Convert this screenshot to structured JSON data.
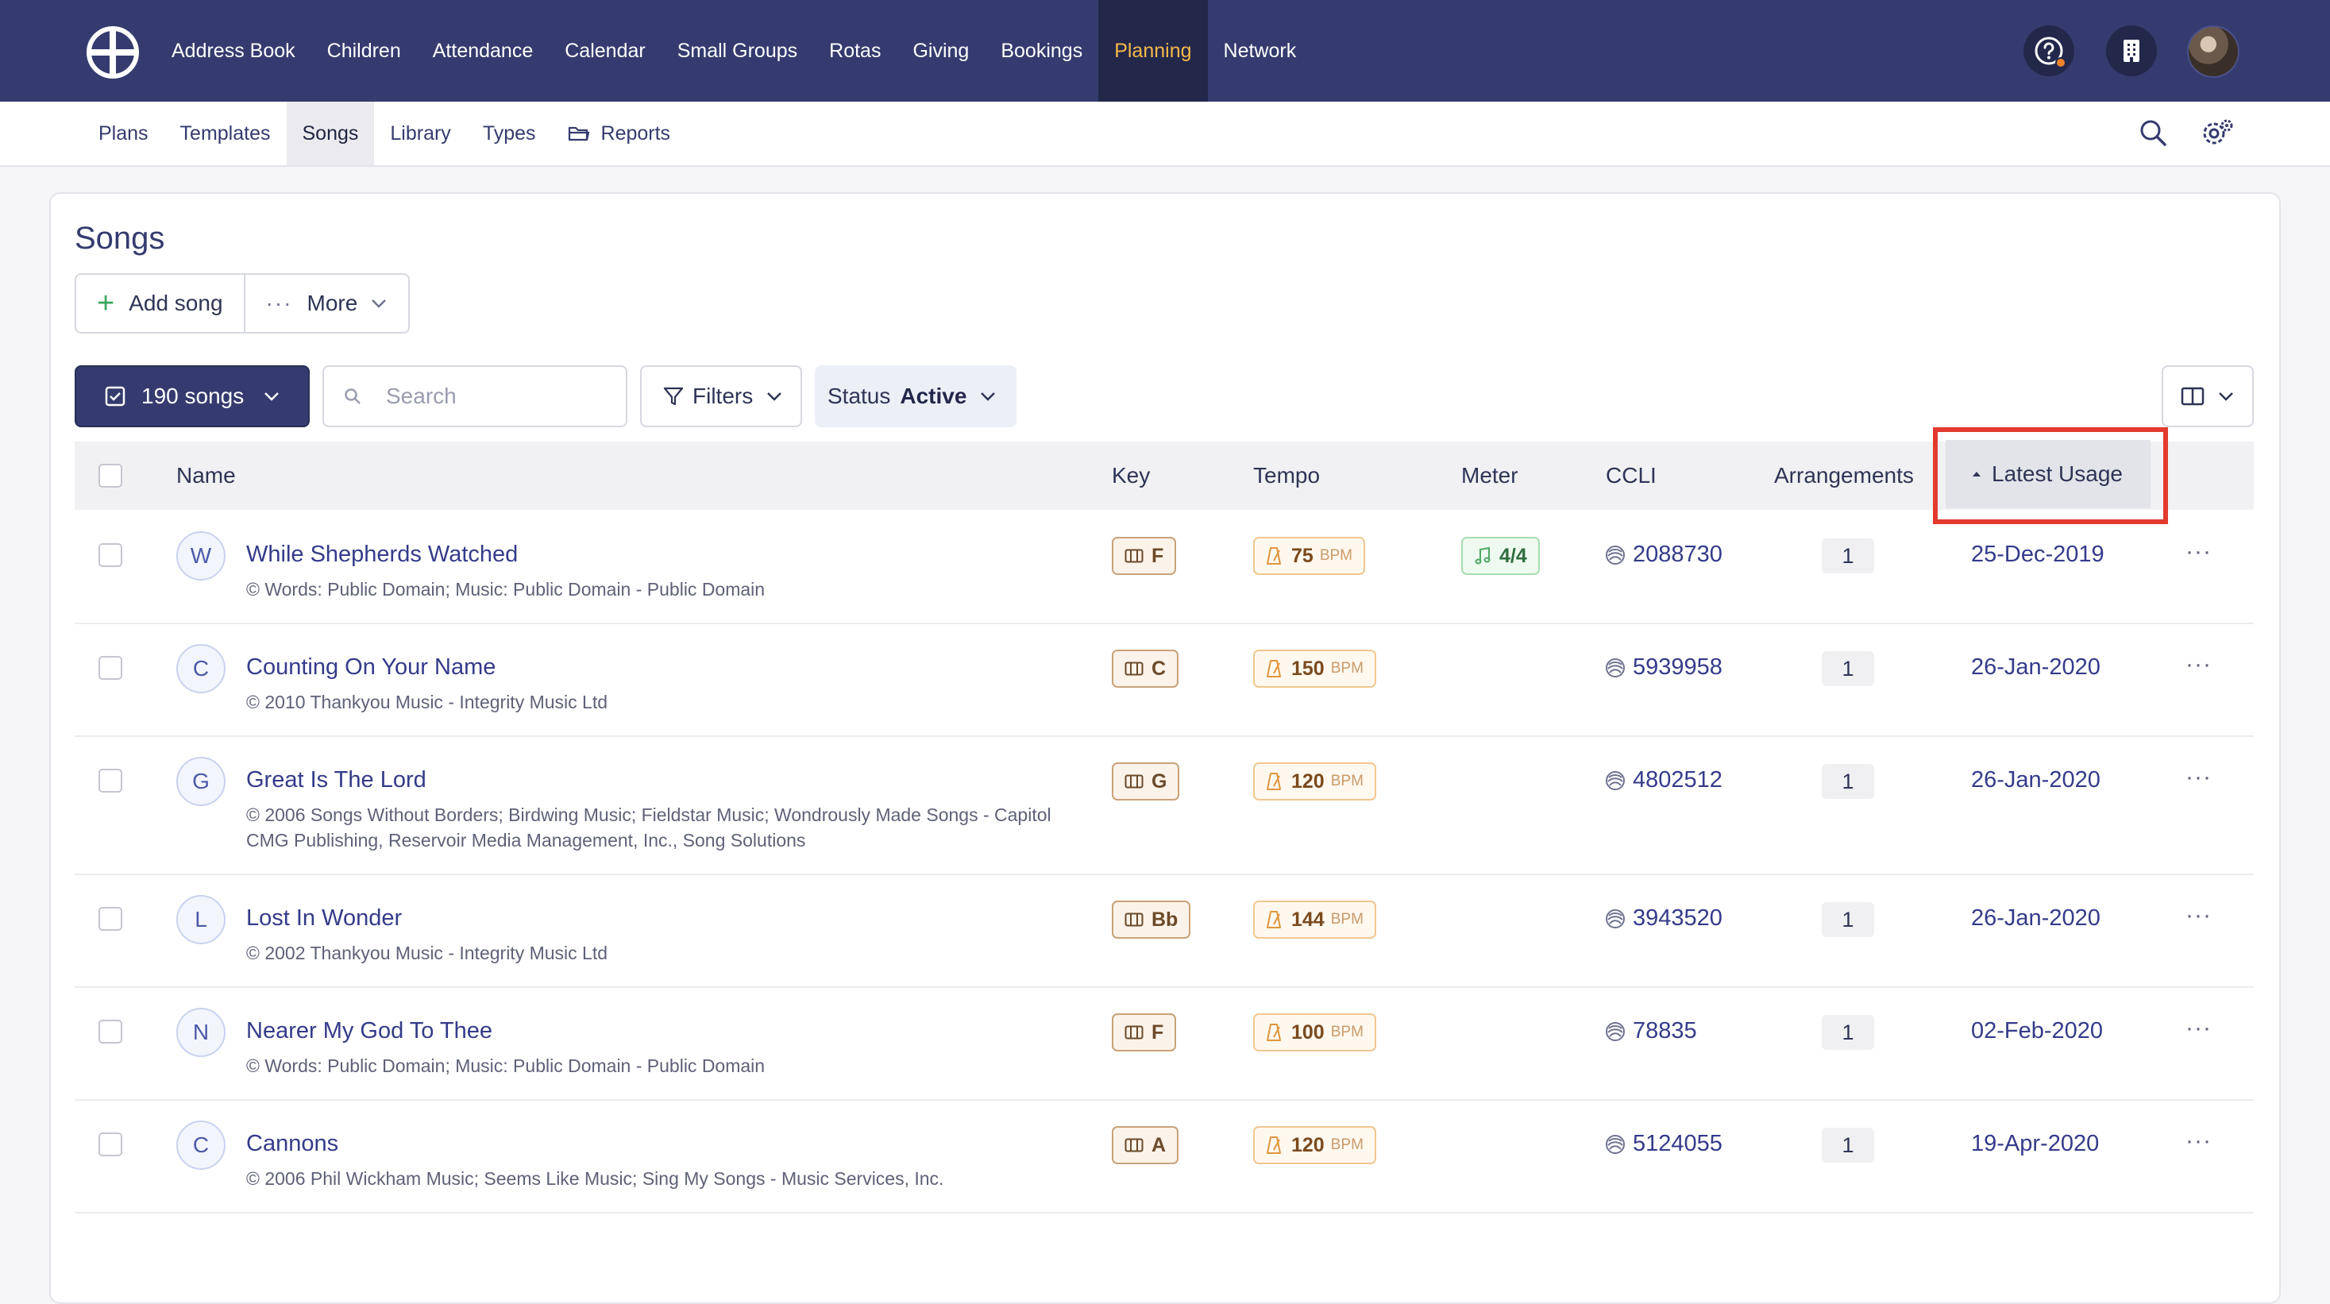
{
  "top_nav": {
    "items": [
      {
        "label": "Address Book",
        "active": false
      },
      {
        "label": "Children",
        "active": false
      },
      {
        "label": "Attendance",
        "active": false
      },
      {
        "label": "Calendar",
        "active": false
      },
      {
        "label": "Small Groups",
        "active": false
      },
      {
        "label": "Rotas",
        "active": false
      },
      {
        "label": "Giving",
        "active": false
      },
      {
        "label": "Bookings",
        "active": false
      },
      {
        "label": "Planning",
        "active": true
      },
      {
        "label": "Network",
        "active": false
      }
    ],
    "right_icons": [
      "help-icon",
      "organisation-icon",
      "avatar"
    ],
    "active_color": "#f5b94a",
    "bar_color": "#353b6e"
  },
  "sub_nav": {
    "items": [
      {
        "label": "Plans",
        "active": false
      },
      {
        "label": "Templates",
        "active": false
      },
      {
        "label": "Songs",
        "active": true
      },
      {
        "label": "Library",
        "active": false
      },
      {
        "label": "Types",
        "active": false
      },
      {
        "label": "Reports",
        "active": false,
        "icon": "folder-icon"
      }
    ],
    "right_icons": [
      "search-icon",
      "settings-icon"
    ]
  },
  "page": {
    "title": "Songs",
    "add_song_label": "Add song",
    "more_label": "More",
    "count_label": "190 songs",
    "search_placeholder": "Search",
    "filters_label": "Filters",
    "status_label": "Status",
    "status_value": "Active"
  },
  "table": {
    "columns": {
      "name": "Name",
      "key": "Key",
      "tempo": "Tempo",
      "meter": "Meter",
      "ccli": "CCLI",
      "arrangements": "Arrangements",
      "latest_usage": "Latest Usage"
    },
    "sorted_by": "Latest Usage",
    "sort_direction": "ascending",
    "bpm_unit": "BPM",
    "rows": [
      {
        "letter": "W",
        "name": "While Shepherds Watched",
        "copyright": "© Words: Public Domain; Music: Public Domain - Public Domain",
        "key": "F",
        "tempo": "75",
        "meter": "4/4",
        "ccli": "2088730",
        "arrangements": "1",
        "latest_usage": "25-Dec-2019"
      },
      {
        "letter": "C",
        "name": "Counting On Your Name",
        "copyright": "© 2010 Thankyou Music - Integrity Music Ltd",
        "key": "C",
        "tempo": "150",
        "meter": "",
        "ccli": "5939958",
        "arrangements": "1",
        "latest_usage": "26-Jan-2020"
      },
      {
        "letter": "G",
        "name": "Great Is The Lord",
        "copyright": "© 2006 Songs Without Borders; Birdwing Music; Fieldstar Music; Wondrously Made Songs - Capitol CMG Publishing, Reservoir Media Management, Inc., Song Solutions",
        "key": "G",
        "tempo": "120",
        "meter": "",
        "ccli": "4802512",
        "arrangements": "1",
        "latest_usage": "26-Jan-2020"
      },
      {
        "letter": "L",
        "name": "Lost In Wonder",
        "copyright": "© 2002 Thankyou Music - Integrity Music Ltd",
        "key": "Bb",
        "tempo": "144",
        "meter": "",
        "ccli": "3943520",
        "arrangements": "1",
        "latest_usage": "26-Jan-2020"
      },
      {
        "letter": "N",
        "name": "Nearer My God To Thee",
        "copyright": "© Words: Public Domain; Music: Public Domain - Public Domain",
        "key": "F",
        "tempo": "100",
        "meter": "",
        "ccli": "78835",
        "arrangements": "1",
        "latest_usage": "02-Feb-2020"
      },
      {
        "letter": "C",
        "name": "Cannons",
        "copyright": "© 2006 Phil Wickham Music; Seems Like Music; Sing My Songs - Music Services, Inc.",
        "key": "A",
        "tempo": "120",
        "meter": "",
        "ccli": "5124055",
        "arrangements": "1",
        "latest_usage": "19-Apr-2020"
      }
    ]
  }
}
